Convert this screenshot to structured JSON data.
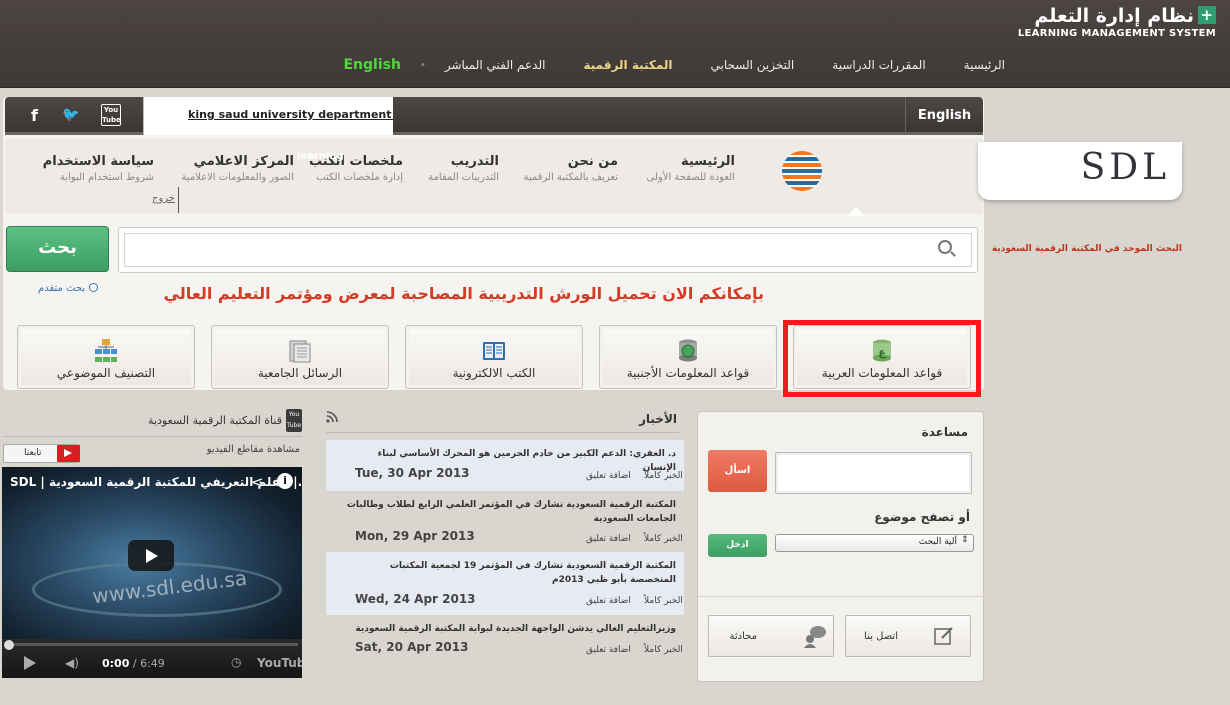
{
  "topbar": {
    "logo_ar": "نظام إدارة التعلم",
    "logo_plus": "+",
    "logo_en": "LEARNING MANAGEMENT SYSTEM",
    "nav": [
      "الرئيسية",
      "المقررات الدراسية",
      "التخزين السحابي",
      "المكتبة الرقمية",
      "الدعم الفني المباشر"
    ],
    "active": "المكتبة الرقمية",
    "separator": "•",
    "english": "English"
  },
  "socialbar": {
    "facebook": "f",
    "twitter": "🐦",
    "youtube_top": "You",
    "youtube_bottom": "Tube",
    "ticker": "king saud university department of e",
    "english": "English"
  },
  "header": {
    "logo": "SDL",
    "nav": [
      {
        "title": "الرئيسية",
        "sub": "العودة للصفحة الأولى"
      },
      {
        "title": "من نحن",
        "sub": "تعريف بالمكتبة الرقمية"
      },
      {
        "title": "التدريب",
        "sub": "التدريبات المقامة"
      },
      {
        "title": "ملخصات الكتب",
        "sub": "إدارة ملخصات الكتب"
      },
      {
        "title": "المركز الاعلامي",
        "sub": "الصور والمعلومات الاعلامية"
      },
      {
        "title": "سياسة الاستخدام",
        "sub": "شروط استخدام البوابة"
      }
    ],
    "learning_overlay": "learning",
    "logout": "خروج"
  },
  "search": {
    "label": "البحث الموحد في المكتبة الرقمية السعودية",
    "button": "بحث",
    "advanced": "بحث متقدم"
  },
  "announcement": "بإمكانكم الان تحميل الورش التدريبية المصاحبة لمعرض ومؤتمر التعليم العالي",
  "tiles": [
    {
      "label": "قواعد المعلومات العربية",
      "icon": "arabic-database-icon"
    },
    {
      "label": "قواعد المعلومات الأجنبية",
      "icon": "foreign-database-icon"
    },
    {
      "label": "الكتب الالكترونية",
      "icon": "ebook-icon"
    },
    {
      "label": "الرسائل الجامعية",
      "icon": "theses-icon"
    },
    {
      "label": "التصنيف الموضوعي",
      "icon": "subject-classification-icon"
    }
  ],
  "help": {
    "title": "مساعدة",
    "ask": "اسأل",
    "browse": "أو تصفح موضوع",
    "select_value": "آلية البحث",
    "enter": "ادخل",
    "contact": "اتصل بنا",
    "chat": "محادثة"
  },
  "news": {
    "title": "الأخبار",
    "items": [
      {
        "headline": "د. العقري: الدعم الكبير من خادم الحرمين هو المحرك الأساسي لبناء الإنسان",
        "full": "الخبر كاملاً",
        "comment": "اضافة تعليق",
        "date": "Tue, 30 Apr 2013"
      },
      {
        "headline": "المكتبة الرقمية السعودية تشارك في المؤتمر العلمي الرابع لطلاب وطالبات الجامعات السعودية",
        "full": "الخبر كاملاً",
        "comment": "اضافة تعليق",
        "date": "Mon, 29 Apr 2013"
      },
      {
        "headline": "المكتبة الرقمية السعودية تشارك في المؤتمر 19 لجمعية المكتبات المتخصصة بأبو ظبي 2013م",
        "full": "الخبر كاملاً",
        "comment": "اضافة تعليق",
        "date": "Wed, 24 Apr 2013"
      },
      {
        "headline": "وزيرالتعليم العالي يدشن الواجهة الجديدة لبوابة المكتبة الرقمية السعودية",
        "full": "الخبر كاملاً",
        "comment": "اضافة تعليق",
        "date": "Sat, 20 Apr 2013"
      }
    ]
  },
  "channel": {
    "title": "قناة المكتبة الرقمية السعودية",
    "yt_top": "You",
    "yt_bottom": "Tube",
    "watch": "مشاهدة مقاطع الفيديو",
    "follow": "تابعنا"
  },
  "video": {
    "title": "SDL | الفلم التعريفي للمكتبة الرقمية السعودية |...",
    "url": "www.sdl.edu.sa",
    "time_current": "0:00",
    "time_total": " / 6:49",
    "brand": "YouTube"
  }
}
